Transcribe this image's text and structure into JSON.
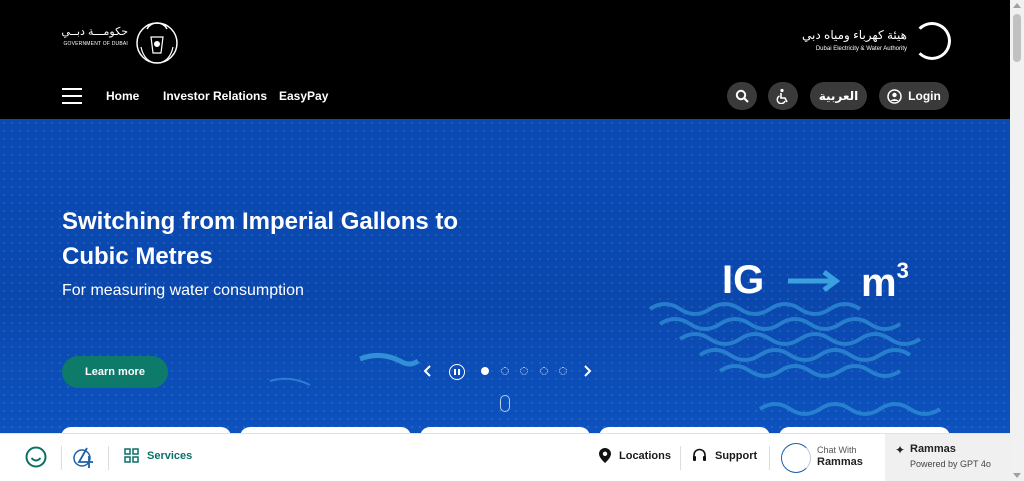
{
  "header": {
    "gov_logo": {
      "arabic": "حكومـــة دبــي",
      "english": "GOVERNMENT OF DUBAI"
    },
    "dewa_logo": {
      "arabic": "هيئة كهرباء ومياه دبي",
      "english": "Dubai Electricity & Water Authority"
    },
    "nav": {
      "home": "Home",
      "investor_relations": "Investor Relations",
      "easypay": "EasyPay"
    },
    "actions": {
      "language": "العربية",
      "login": "Login"
    },
    "colors": {
      "background": "#000000",
      "pill": "#3a3a3a"
    }
  },
  "hero": {
    "title": "Switching from Imperial Gallons to Cubic Metres",
    "subtitle": "For measuring water consumption",
    "cta": "Learn more",
    "graphic": {
      "from": "IG",
      "to": "m",
      "to_superscript": "3"
    },
    "carousel": {
      "active_slide": 1,
      "slide_count": 5
    },
    "colors": {
      "background": "#0a4ab3",
      "cta": "#0d7a6a",
      "wave": "#2f8fd6"
    }
  },
  "bottom_bar": {
    "services": "Services",
    "locations": "Locations",
    "support": "Support",
    "chat": {
      "line1": "Chat With",
      "line2": "Rammas"
    },
    "rammas": {
      "title": "Rammas",
      "subtitle": "Powered by GPT 4o"
    },
    "colors": {
      "accent": "#0d6f66"
    }
  },
  "icons": [
    "hamburger-icon",
    "search-icon",
    "accessibility-icon",
    "user-icon",
    "smile-icon",
    "brand-icon",
    "grid-icon",
    "location-pin-icon",
    "headset-icon",
    "sparkle-icon"
  ]
}
